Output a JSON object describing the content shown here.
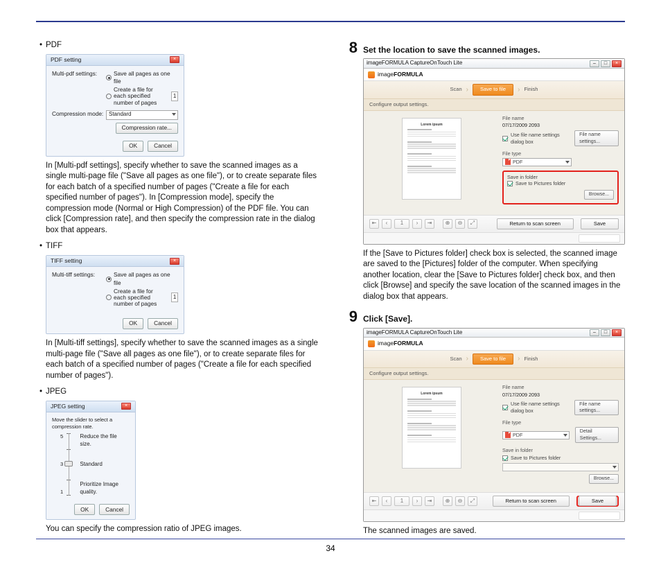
{
  "page_number": "34",
  "left": {
    "pdf": {
      "bullet_label": "PDF",
      "dlg_title": "PDF setting",
      "label_multi": "Multi-pdf settings:",
      "radio1": "Save all pages as one file",
      "radio2": "Create a file for each specified number of pages",
      "spin_value": "1",
      "label_comp": "Compression mode:",
      "comp_value": "Standard",
      "btn_rate": "Compression rate...",
      "btn_ok": "OK",
      "btn_cancel": "Cancel",
      "para": "In [Multi-pdf settings], specify whether to save the scanned images as a single multi-page file (\"Save all pages as one file\"), or to create separate files for each batch of a specified number of pages (\"Create a file for each specified number of pages\"). In [Compression mode], specify the compression mode (Normal or High Compression) of the PDF file. You can click [Compression rate], and then specify the compression rate in the dialog box that appears."
    },
    "tiff": {
      "bullet_label": "TIFF",
      "dlg_title": "TIFF setting",
      "label_multi": "Multi-tiff settings:",
      "radio1": "Save all pages as one file",
      "radio2": "Create a file for each specified number of pages",
      "spin_value": "1",
      "btn_ok": "OK",
      "btn_cancel": "Cancel",
      "para": "In [Multi-tiff settings], specify whether to save the scanned images as a single multi-page file (\"Save all pages as one file\"), or to create separate files for each batch of a specified number of pages (\"Create a file for each specified number of pages\")."
    },
    "jpeg": {
      "bullet_label": "JPEG",
      "dlg_title": "JPEG setting",
      "instruction": "Move the slider to select a compression rate.",
      "s5": "5",
      "s3": "3",
      "s1": "1",
      "l5": "Reduce the file size.",
      "l3": "Standard",
      "l1": "Prioritize Image quality.",
      "btn_ok": "OK",
      "btn_cancel": "Cancel",
      "para": "You can specify the compression ratio of JPEG images."
    }
  },
  "right": {
    "step8": {
      "num": "8",
      "title": "Set the location to save the scanned images.",
      "para": "If the [Save to Pictures folder] check box is selected, the scanned image are saved to the [Pictures] folder of the computer. When specifying another location, clear the [Save to Pictures folder] check box, and then click [Browse] and specify the save location of the scanned images in the dialog box that appears."
    },
    "step9": {
      "num": "9",
      "title": "Click [Save].",
      "para": "The scanned images are saved."
    },
    "ifwin": {
      "wintitle": "imageFORMULA CaptureOnTouch Lite",
      "brand_a": "image",
      "brand_b": "FORMULA",
      "prog_scan": "Scan",
      "prog_save": "Save to file",
      "prog_finish": "Finish",
      "subbar": "Configure output settings.",
      "doc_title": "Lorem ipsum",
      "grp_filename": "File name",
      "filename_val": "07/17/2009 2093",
      "chk_usefilenamedlg": "Use file name settings dialog box",
      "btn_filenamesettings": "File name settings...",
      "grp_filetype": "File type",
      "filetype_val": "PDF",
      "btn_detail": "Detail Settings...",
      "grp_savein": "Save in folder",
      "chk_savepictures": "Save to Pictures folder",
      "btn_browse": "Browse...",
      "btn_return": "Return to scan screen",
      "btn_save": "Save"
    }
  }
}
